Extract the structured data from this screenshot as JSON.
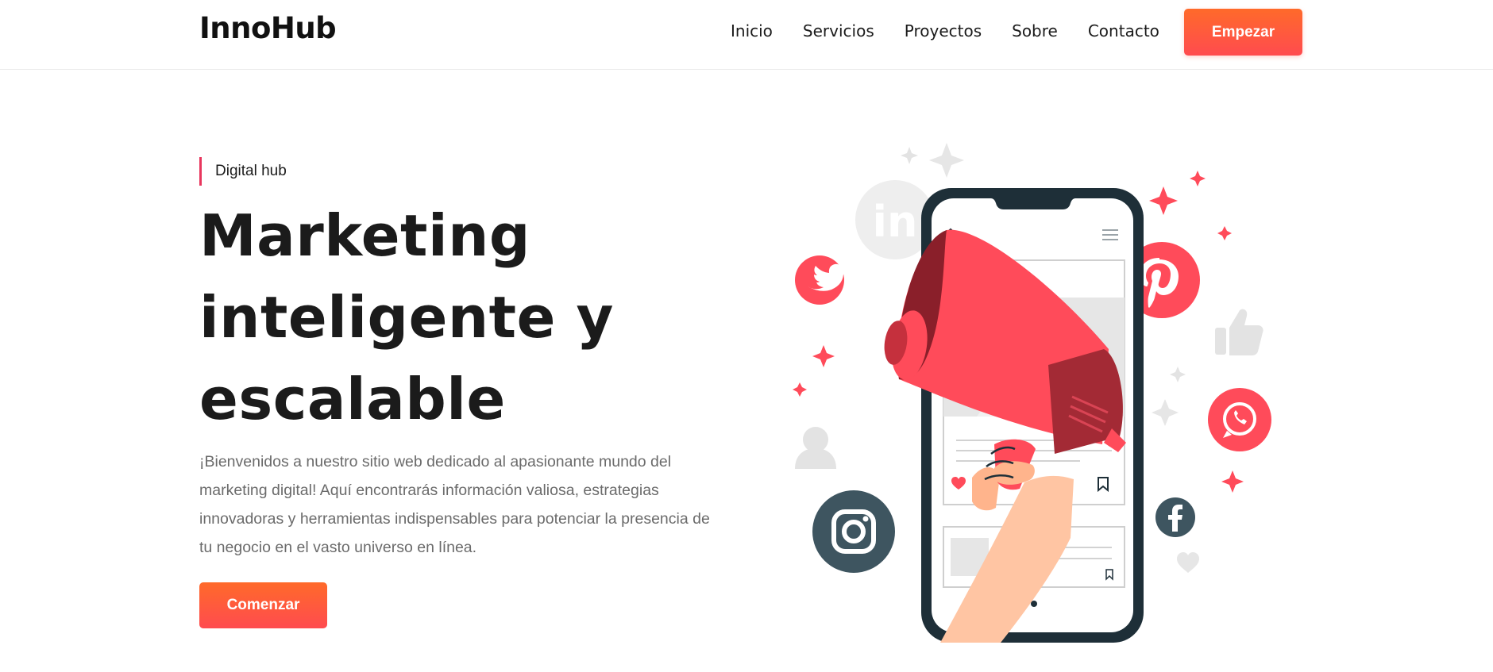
{
  "header": {
    "logo": "InnoHub",
    "nav": [
      "Inicio",
      "Servicios",
      "Proyectos",
      "Sobre",
      "Contacto"
    ],
    "cta_label": "Empezar"
  },
  "hero": {
    "eyebrow": "Digital hub",
    "headline_lines": [
      "Marketing",
      "inteligente y",
      "escalable"
    ],
    "intro_lines": [
      "¡Bienvenidos a nuestro sitio web dedicado al apasionante mundo del",
      "marketing digital! Aquí encontrarás información valiosa, estrategias",
      "innovadoras y herramientas indispensables para potenciar la presencia de",
      "tu negocio en el vasto universo en línea."
    ],
    "cta_label": "Comenzar"
  },
  "illustration": {
    "icons": [
      "linkedin-icon",
      "twitter-icon",
      "pinterest-icon",
      "thumbs-up-icon",
      "whatsapp-icon",
      "user-icon",
      "instagram-icon",
      "facebook-icon",
      "heart-icon",
      "megaphone-icon",
      "smartphone-icon"
    ]
  },
  "colors": {
    "accent_orange": "#ff6a2a",
    "accent_red": "#ff4b5a",
    "eyebrow_bar": "#e8365d",
    "dark_teal": "#1e2f38",
    "slate_icon": "#3e5560"
  }
}
